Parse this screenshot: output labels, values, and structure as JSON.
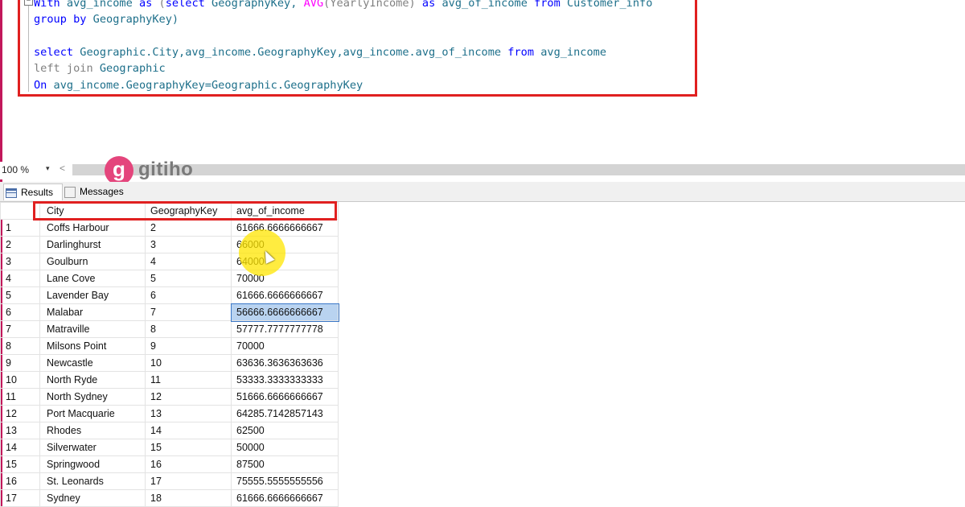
{
  "editor": {
    "collapse_glyph": "−",
    "line1": {
      "kw1": "With",
      "t1": " avg_income ",
      "kw2": "as",
      "t2": " (",
      "kw3": "select",
      "t3": " GeographyKey, ",
      "fn": "AVG",
      "t4": "(YearlyIncome) ",
      "kw4": "as",
      "t5": " avg_of_income ",
      "kw5": "from",
      "t6": " Customer_info"
    },
    "line2": {
      "kw1": "group by",
      "t1": " GeographyKey)"
    },
    "line3": {
      "kw1": "select",
      "t1": " Geographic.City,avg_income.GeographyKey,avg_income.avg_of_income ",
      "kw2": "from",
      "t2": " avg_income"
    },
    "line4": {
      "gr": "left join",
      "t1": " Geographic"
    },
    "line5": {
      "kw1": "On",
      "t1": " avg_income.GeographyKey=Geographic.GeographyKey"
    }
  },
  "toolbar": {
    "zoom": "100 %",
    "zoom_arrow": "▾",
    "scroll_left": "<"
  },
  "watermark": {
    "logo_letter": "g",
    "brand": "gitiho"
  },
  "tabs": {
    "results": "Results",
    "messages": "Messages"
  },
  "colors": {
    "sql_box_border": "#e02020",
    "selection": "#b9d3f0",
    "keyword": "#0000ff",
    "function": "#ff00ff",
    "identifier": "#1d6f8a",
    "logo": "#e4457c"
  },
  "grid": {
    "columns": [
      "City",
      "GeographyKey",
      "avg_of_income"
    ],
    "rows": [
      {
        "n": "1",
        "city": "Coffs Harbour",
        "key": "2",
        "avg": "61666.6666666667"
      },
      {
        "n": "2",
        "city": "Darlinghurst",
        "key": "3",
        "avg": "66000"
      },
      {
        "n": "3",
        "city": "Goulburn",
        "key": "4",
        "avg": "64000"
      },
      {
        "n": "4",
        "city": "Lane Cove",
        "key": "5",
        "avg": "70000"
      },
      {
        "n": "5",
        "city": "Lavender Bay",
        "key": "6",
        "avg": "61666.6666666667"
      },
      {
        "n": "6",
        "city": "Malabar",
        "key": "7",
        "avg": "56666.6666666667"
      },
      {
        "n": "7",
        "city": "Matraville",
        "key": "8",
        "avg": "57777.7777777778"
      },
      {
        "n": "8",
        "city": "Milsons Point",
        "key": "9",
        "avg": "70000"
      },
      {
        "n": "9",
        "city": "Newcastle",
        "key": "10",
        "avg": "63636.3636363636"
      },
      {
        "n": "10",
        "city": "North Ryde",
        "key": "11",
        "avg": "53333.3333333333"
      },
      {
        "n": "11",
        "city": "North Sydney",
        "key": "12",
        "avg": "51666.6666666667"
      },
      {
        "n": "12",
        "city": "Port Macquarie",
        "key": "13",
        "avg": "64285.7142857143"
      },
      {
        "n": "13",
        "city": "Rhodes",
        "key": "14",
        "avg": "62500"
      },
      {
        "n": "14",
        "city": "Silverwater",
        "key": "15",
        "avg": "50000"
      },
      {
        "n": "15",
        "city": "Springwood",
        "key": "16",
        "avg": "87500"
      },
      {
        "n": "16",
        "city": "St. Leonards",
        "key": "17",
        "avg": "75555.5555555556"
      },
      {
        "n": "17",
        "city": "Sydney",
        "key": "18",
        "avg": "61666.6666666667"
      }
    ]
  }
}
